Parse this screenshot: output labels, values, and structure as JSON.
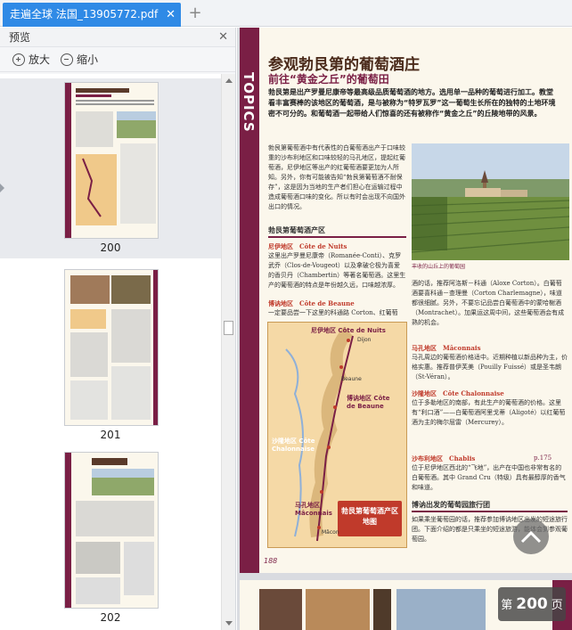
{
  "tab": {
    "title": "走遍全球  法国_13905772.pdf",
    "close_icon": "close-icon"
  },
  "sidebar": {
    "title": "预览",
    "zoom_in_label": "放大",
    "zoom_out_label": "缩小",
    "thumbnails": [
      {
        "page": "200",
        "selected": true
      },
      {
        "page": "201",
        "selected": false
      },
      {
        "page": "202",
        "selected": false
      }
    ]
  },
  "document": {
    "section_tag": "TOPICS",
    "headline": "参观勃艮第的葡萄酒庄",
    "subheadline": "前往“黄金之丘”的葡萄田",
    "intro": "勃艮第是出产罗曼尼康帝等最高级品质葡萄酒的地方。选用单一品种的葡萄进行加工。教堂看丰富赛棒的该地区的葡萄酒，是与被称为“特罗瓦罗”这一葡萄生长所在的独特的土地环境密不可分的。和葡萄酒一起带给人们惊喜的还有被称作“黄金之丘”的丘陵地带的风景。",
    "body_left": "勃艮第葡萄酒中有代表性的白葡萄酒出产于口味较重的沙布利地区和口味较轻的马孔地区，提起红葡萄酒，尼伊地区等出产的红葡萄酒要更加为人所知。另外，你有可能被告知“勃艮第葡萄酒不耐保存”，这是因为当地的生产者们担心在运输过程中造成葡萄酒口味的变化。所以有时会出现不向国外出口的情况。",
    "section_production": "勃艮第葡萄酒产区",
    "region_nuits": "尼伊地区　Côte de Nuits",
    "region_nuits_text": "这里出产罗曼尼康帝（Romanée-Conti）、克罗武乔（Clos-de-Vougeot）以及拿破仑极为喜爱的香贝丹（Chambertin）等著名葡萄酒。这里生产的葡萄酒的特点是年份越久远，口味越浓厚。",
    "region_beaune": "博讷地区　Côte de Beaune",
    "region_beaune_text": "一定要品尝一下这里的科通路 Corton、红葡萄",
    "photo_caption": "丰收的山丘上的葡萄园",
    "body_right_1": "酒的话，推荐阿洛斯－科通（Aloxe Corton）。白葡萄酒要喜科通－查理曼（Corton Charlemagne），味道都很细腻。另外，不要忘记品尝白葡萄酒中的蒙哈榭酒（Montrachet）。加果运这周中间，这些葡萄酒会有成熟的机会。",
    "region_maconnais": "马孔地区　Mâconnais",
    "region_maconnais_text": "马孔周边的葡萄酒价格适中。近期种植以新品种为主，价格实惠。推荐普伊芙美（Pouilly Fuissé）或是圣韦朗（St-Véran）。",
    "region_chalonnaise": "沙隆地区　Côte Chalonnaise",
    "region_chalonnaise_text": "位于多勒地区的南部，有此生产的葡萄酒的价格。这里有“利口酒”——白葡萄酒阿里戈蒂（Aligoté）以红葡萄酒为主的梅尔屈雷（Mercurey）。",
    "region_chablis": "沙布利地区　Chablis",
    "region_chablis_ref": "p.175",
    "region_chablis_text": "位于尼伊地区西北的“飞地”，出产在中国也非常有名的白葡萄酒。其中 Grand Cru（特级）具有最醇厚的香气和味道。",
    "section_tour": "博讷出发的葡萄园旅行团",
    "tour_text": "如果乘坐葡萄园的话，推荐参加博讷地区出发的短途旅行团。下面介绍的都是只乘坐的短途旅游，能体会到参观葡萄园。",
    "map_title": "勃艮第葡萄酒产区地图",
    "map_labels": [
      "尼伊地区 Côte de Nuits",
      "Dijon",
      "博讷地区 Côte de Beaune",
      "沙隆地区 Côte Chalonnaise",
      "马孔地区 Mâconnais",
      "Beaune",
      "Mâcon"
    ],
    "page_number": "188"
  },
  "overlay": {
    "page_prefix": "第",
    "page_current": "200",
    "page_suffix": "页"
  },
  "colors": {
    "tab_active": "#2f8ae6",
    "accent": "#7a1f45"
  }
}
